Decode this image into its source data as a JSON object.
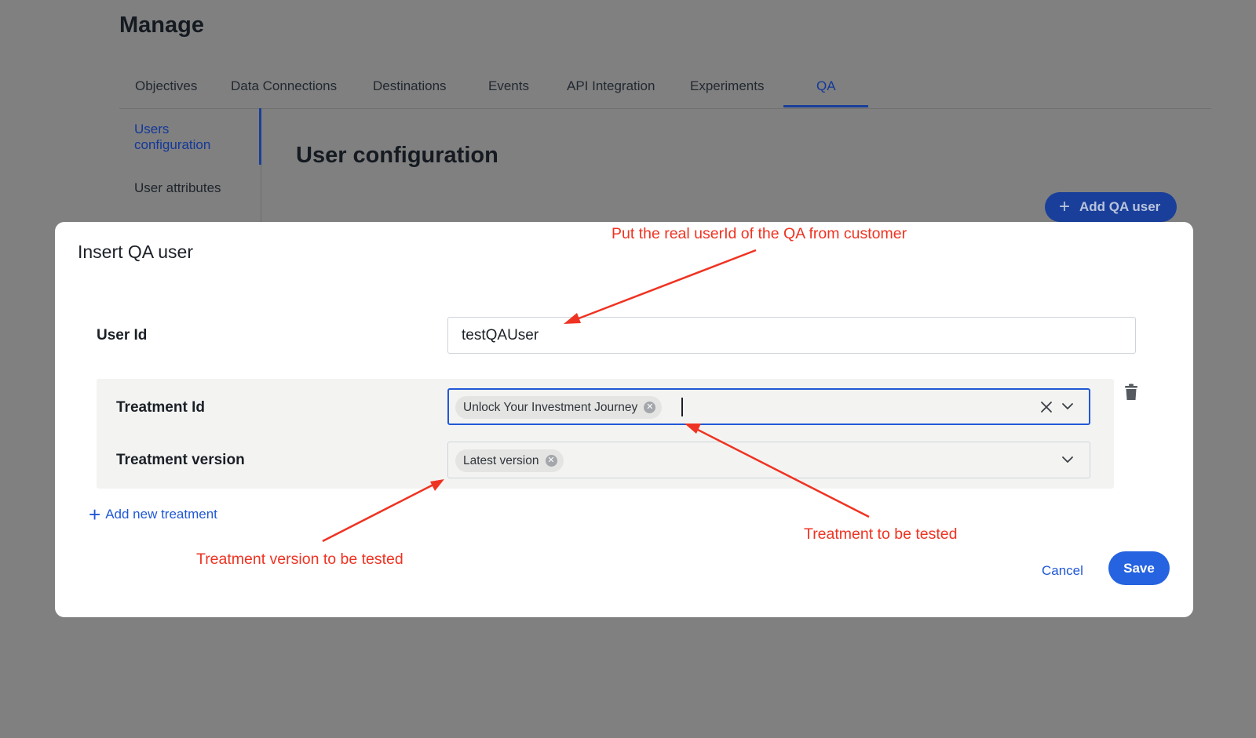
{
  "page": {
    "title": "Manage"
  },
  "tabs": [
    {
      "label": "Objectives"
    },
    {
      "label": "Data Connections"
    },
    {
      "label": "Destinations"
    },
    {
      "label": "Events"
    },
    {
      "label": "API Integration"
    },
    {
      "label": "Experiments"
    },
    {
      "label": "QA",
      "active": true
    }
  ],
  "subnav": {
    "items": [
      {
        "label": "Users configuration",
        "active": true
      },
      {
        "label": "User attributes"
      }
    ]
  },
  "section": {
    "title": "User configuration",
    "add_button": "Add QA user"
  },
  "modal": {
    "title": "Insert QA user",
    "user_id": {
      "label": "User Id",
      "value": "testQAUser"
    },
    "treatment_id": {
      "label": "Treatment Id",
      "selected": "Unlock Your Investment Journey"
    },
    "treatment_version": {
      "label": "Treatment version",
      "selected": "Latest version"
    },
    "add_treatment": "Add new treatment",
    "cancel": "Cancel",
    "save": "Save"
  },
  "annotations": {
    "user_id_note": "Put the real userId of the QA from customer",
    "treatment_note": "Treatment to be tested",
    "version_note": "Treatment version to be tested",
    "color": "#ef3322"
  },
  "colors": {
    "accent": "#2158d6",
    "overlay": "#808080",
    "active_tab": "#13389a"
  }
}
